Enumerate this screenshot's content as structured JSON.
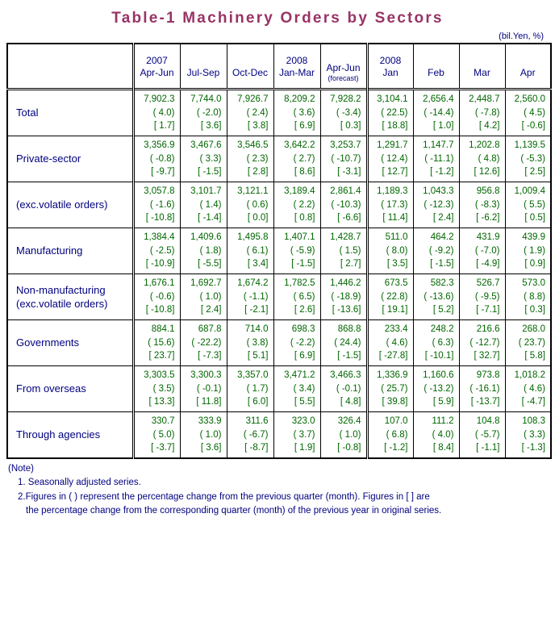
{
  "title": "Table-1  Machinery  Orders  by  Sectors",
  "unit_label": "(bil.Yen, %)",
  "header": {
    "blank_label": "",
    "columns": [
      {
        "year": "2007",
        "period": "Apr-Jun",
        "note": ""
      },
      {
        "year": "",
        "period": "Jul-Sep",
        "note": ""
      },
      {
        "year": "",
        "period": "Oct-Dec",
        "note": ""
      },
      {
        "year": "2008",
        "period": "Jan-Mar",
        "note": ""
      },
      {
        "year": "",
        "period": "Apr-Jun",
        "note": "(forecast)"
      },
      {
        "year": "2008",
        "period": "Jan",
        "note": ""
      },
      {
        "year": "",
        "period": "Feb",
        "note": ""
      },
      {
        "year": "",
        "period": "Mar",
        "note": ""
      },
      {
        "year": "",
        "period": "Apr",
        "note": ""
      }
    ]
  },
  "rows": [
    {
      "label": "Total",
      "label2": "",
      "indent": 0,
      "cells": [
        {
          "value": "7,902.3",
          "qoq": "( 4.0)",
          "yoy": "[ 1.7]"
        },
        {
          "value": "7,744.0",
          "qoq": "( -2.0)",
          "yoy": "[ 3.6]"
        },
        {
          "value": "7,926.7",
          "qoq": "( 2.4)",
          "yoy": "[ 3.8]"
        },
        {
          "value": "8,209.2",
          "qoq": "( 3.6)",
          "yoy": "[ 6.9]"
        },
        {
          "value": "7,928.2",
          "qoq": "( -3.4)",
          "yoy": "[ 0.3]"
        },
        {
          "value": "3,104.1",
          "qoq": "( 22.5)",
          "yoy": "[ 18.8]"
        },
        {
          "value": "2,656.4",
          "qoq": "( -14.4)",
          "yoy": "[ 1.0]"
        },
        {
          "value": "2,448.7",
          "qoq": "( -7.8)",
          "yoy": "[ 4.2]"
        },
        {
          "value": "2,560.0",
          "qoq": "( 4.5)",
          "yoy": "[ -0.6]"
        }
      ]
    },
    {
      "label": "Private-sector",
      "label2": "",
      "indent": 1,
      "cells": [
        {
          "value": "3,356.9",
          "qoq": "( -0.8)",
          "yoy": "[ -9.7]"
        },
        {
          "value": "3,467.6",
          "qoq": "( 3.3)",
          "yoy": "[ -1.5]"
        },
        {
          "value": "3,546.5",
          "qoq": "( 2.3)",
          "yoy": "[ 2.8]"
        },
        {
          "value": "3,642.2",
          "qoq": "( 2.7)",
          "yoy": "[ 8.6]"
        },
        {
          "value": "3,253.7",
          "qoq": "( -10.7)",
          "yoy": "[ -3.1]"
        },
        {
          "value": "1,291.7",
          "qoq": "( 12.4)",
          "yoy": "[ 12.7]"
        },
        {
          "value": "1,147.7",
          "qoq": "( -11.1)",
          "yoy": "[ -1.2]"
        },
        {
          "value": "1,202.8",
          "qoq": "( 4.8)",
          "yoy": "[ 12.6]"
        },
        {
          "value": "1,139.5",
          "qoq": "( -5.3)",
          "yoy": "[ 2.5]"
        }
      ]
    },
    {
      "label": "(exc.volatile orders)",
      "label2": "",
      "indent": 1,
      "cells": [
        {
          "value": "3,057.8",
          "qoq": "( -1.6)",
          "yoy": "[ -10.8]"
        },
        {
          "value": "3,101.7",
          "qoq": "( 1.4)",
          "yoy": "[ -1.4]"
        },
        {
          "value": "3,121.1",
          "qoq": "( 0.6)",
          "yoy": "[ 0.0]"
        },
        {
          "value": "3,189.4",
          "qoq": "( 2.2)",
          "yoy": "[ 0.8]"
        },
        {
          "value": "2,861.4",
          "qoq": "( -10.3)",
          "yoy": "[ -6.6]"
        },
        {
          "value": "1,189.3",
          "qoq": "( 17.3)",
          "yoy": "[ 11.4]"
        },
        {
          "value": "1,043.3",
          "qoq": "( -12.3)",
          "yoy": "[ 2.4]"
        },
        {
          "value": "956.8",
          "qoq": "( -8.3)",
          "yoy": "[ -6.2]"
        },
        {
          "value": "1,009.4",
          "qoq": "( 5.5)",
          "yoy": "[ 0.5]"
        }
      ]
    },
    {
      "label": "Manufacturing",
      "label2": "",
      "indent": 2,
      "cells": [
        {
          "value": "1,384.4",
          "qoq": "( -2.5)",
          "yoy": "[ -10.9]"
        },
        {
          "value": "1,409.6",
          "qoq": "( 1.8)",
          "yoy": "[ -5.5]"
        },
        {
          "value": "1,495.8",
          "qoq": "( 6.1)",
          "yoy": "[ 3.4]"
        },
        {
          "value": "1,407.1",
          "qoq": "( -5.9)",
          "yoy": "[ -1.5]"
        },
        {
          "value": "1,428.7",
          "qoq": "( 1.5)",
          "yoy": "[ 2.7]"
        },
        {
          "value": "511.0",
          "qoq": "( 8.0)",
          "yoy": "[ 3.5]"
        },
        {
          "value": "464.2",
          "qoq": "( -9.2)",
          "yoy": "[ -1.5]"
        },
        {
          "value": "431.9",
          "qoq": "( -7.0)",
          "yoy": "[ -4.9]"
        },
        {
          "value": "439.9",
          "qoq": "( 1.9)",
          "yoy": "[ 0.9]"
        }
      ]
    },
    {
      "label": "Non-manufacturing",
      "label2": "(exc.volatile orders)",
      "indent": 2,
      "cells": [
        {
          "value": "1,676.1",
          "qoq": "( -0.6)",
          "yoy": "[ -10.8]"
        },
        {
          "value": "1,692.7",
          "qoq": "( 1.0)",
          "yoy": "[ 2.4]"
        },
        {
          "value": "1,674.2",
          "qoq": "( -1.1)",
          "yoy": "[ -2.1]"
        },
        {
          "value": "1,782.5",
          "qoq": "( 6.5)",
          "yoy": "[ 2.6]"
        },
        {
          "value": "1,446.2",
          "qoq": "( -18.9)",
          "yoy": "[ -13.6]"
        },
        {
          "value": "673.5",
          "qoq": "( 22.8)",
          "yoy": "[ 19.1]"
        },
        {
          "value": "582.3",
          "qoq": "( -13.6)",
          "yoy": "[ 5.2]"
        },
        {
          "value": "526.7",
          "qoq": "( -9.5)",
          "yoy": "[ -7.1]"
        },
        {
          "value": "573.0",
          "qoq": "( 8.8)",
          "yoy": "[ 0.3]"
        }
      ]
    },
    {
      "label": "Governments",
      "label2": "",
      "indent": 1,
      "cells": [
        {
          "value": "884.1",
          "qoq": "( 15.6)",
          "yoy": "[ 23.7]"
        },
        {
          "value": "687.8",
          "qoq": "( -22.2)",
          "yoy": "[ -7.3]"
        },
        {
          "value": "714.0",
          "qoq": "( 3.8)",
          "yoy": "[ 5.1]"
        },
        {
          "value": "698.3",
          "qoq": "( -2.2)",
          "yoy": "[ 6.9]"
        },
        {
          "value": "868.8",
          "qoq": "( 24.4)",
          "yoy": "[ -1.5]"
        },
        {
          "value": "233.4",
          "qoq": "( 4.6)",
          "yoy": "[ -27.8]"
        },
        {
          "value": "248.2",
          "qoq": "( 6.3)",
          "yoy": "[ -10.1]"
        },
        {
          "value": "216.6",
          "qoq": "( -12.7)",
          "yoy": "[ 32.7]"
        },
        {
          "value": "268.0",
          "qoq": "( 23.7)",
          "yoy": "[ 5.8]"
        }
      ]
    },
    {
      "label": "From overseas",
      "label2": "",
      "indent": 1,
      "cells": [
        {
          "value": "3,303.5",
          "qoq": "( 3.5)",
          "yoy": "[ 13.3]"
        },
        {
          "value": "3,300.3",
          "qoq": "( -0.1)",
          "yoy": "[ 11.8]"
        },
        {
          "value": "3,357.0",
          "qoq": "( 1.7)",
          "yoy": "[ 6.0]"
        },
        {
          "value": "3,471.2",
          "qoq": "( 3.4)",
          "yoy": "[ 5.5]"
        },
        {
          "value": "3,466.3",
          "qoq": "( -0.1)",
          "yoy": "[ 4.8]"
        },
        {
          "value": "1,336.9",
          "qoq": "( 25.7)",
          "yoy": "[ 39.8]"
        },
        {
          "value": "1,160.6",
          "qoq": "( -13.2)",
          "yoy": "[ 5.9]"
        },
        {
          "value": "973.8",
          "qoq": "( -16.1)",
          "yoy": "[ -13.7]"
        },
        {
          "value": "1,018.2",
          "qoq": "( 4.6)",
          "yoy": "[ -4.7]"
        }
      ]
    },
    {
      "label": "Through agencies",
      "label2": "",
      "indent": 1,
      "cells": [
        {
          "value": "330.7",
          "qoq": "( 5.0)",
          "yoy": "[ -3.7]"
        },
        {
          "value": "333.9",
          "qoq": "( 1.0)",
          "yoy": "[ 3.6]"
        },
        {
          "value": "311.6",
          "qoq": "( -6.7)",
          "yoy": "[ -8.7]"
        },
        {
          "value": "323.0",
          "qoq": "( 3.7)",
          "yoy": "[ 1.9]"
        },
        {
          "value": "326.4",
          "qoq": "( 1.0)",
          "yoy": "[ -0.8]"
        },
        {
          "value": "107.0",
          "qoq": "( 6.8)",
          "yoy": "[ -1.2]"
        },
        {
          "value": "111.2",
          "qoq": "( 4.0)",
          "yoy": "[ 8.4]"
        },
        {
          "value": "104.8",
          "qoq": "( -5.7)",
          "yoy": "[ -1.1]"
        },
        {
          "value": "108.3",
          "qoq": "( 3.3)",
          "yoy": "[ -1.3]"
        }
      ]
    }
  ],
  "notes": {
    "heading": "(Note)",
    "line1": "1. Seasonally adjusted series.",
    "line2a": "2.Figures in ( ) represent the percentage change from the previous quarter (month). Figures in [ ] are",
    "line2b": "the percentage change from the corresponding quarter (month) of the previous year in original series."
  },
  "colors": {
    "title": "#993366",
    "label_text": "#000080",
    "number_text": "#006600",
    "border": "#000000"
  }
}
